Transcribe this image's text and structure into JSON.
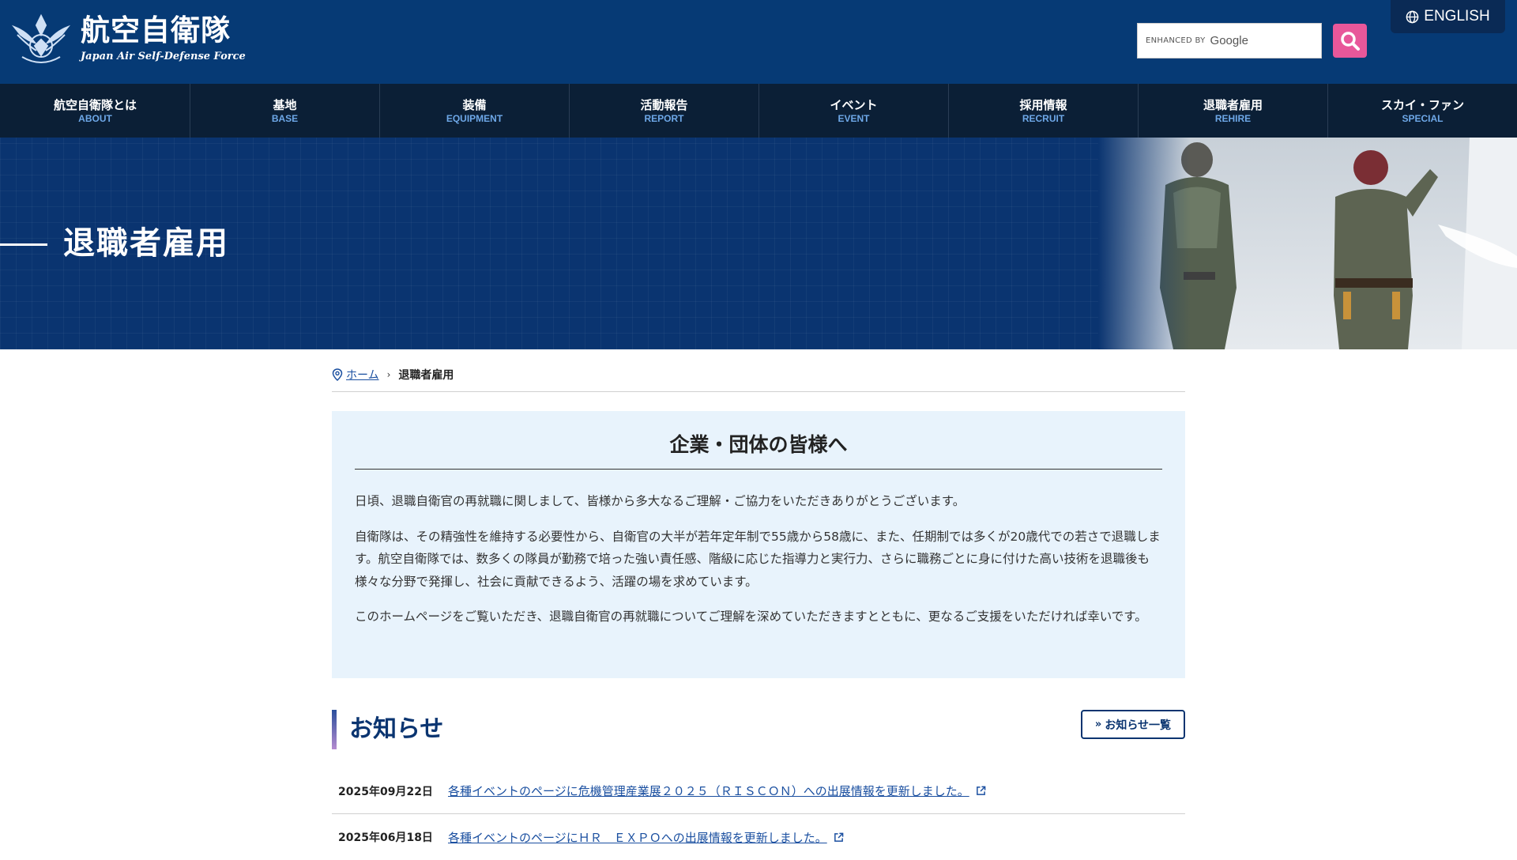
{
  "header": {
    "logo_jp": "航空自衛隊",
    "logo_en": "Japan Air Self-Defense Force",
    "search_enhanced": "ENHANCED BY",
    "search_google": "Google",
    "english_label": "ENGLISH"
  },
  "nav": {
    "items": [
      {
        "jp": "航空自衛隊とは",
        "en": "ABOUT"
      },
      {
        "jp": "基地",
        "en": "BASE"
      },
      {
        "jp": "装備",
        "en": "EQUIPMENT"
      },
      {
        "jp": "活動報告",
        "en": "REPORT"
      },
      {
        "jp": "イベント",
        "en": "EVENT"
      },
      {
        "jp": "採用情報",
        "en": "RECRUIT"
      },
      {
        "jp": "退職者雇用",
        "en": "REHIRE"
      },
      {
        "jp": "スカイ・ファン",
        "en": "SPECIAL"
      }
    ]
  },
  "hero": {
    "title": "退職者雇用"
  },
  "breadcrumb": {
    "home": "ホーム",
    "sep": "›",
    "current": "退職者雇用"
  },
  "message": {
    "title": "企業・団体の皆様へ",
    "p1": "日頃、退職自衛官の再就職に関しまして、皆様から多大なるご理解・ご協力をいただきありがとうございます。",
    "p2": "自衛隊は、その精強性を維持する必要性から、自衛官の大半が若年定年制で55歳から58歳に、また、任期制では多くが20歳代での若さで退職します。航空自衛隊では、数多くの隊員が勤務で培った強い責任感、階級に応じた指導力と実行力、さらに職務ごとに身に付けた高い技術を退職後も様々な分野で発揮し、社会に貢献できるよう、活躍の場を求めています。",
    "p3": "このホームページをご覧いただき、退職自衛官の再就職についてご理解を深めていただきますとともに、更なるご支援をいただければ幸いです。"
  },
  "news": {
    "title": "お知らせ",
    "more_label": "お知らせ一覧",
    "items": [
      {
        "date": "2025年09月22日",
        "text": "各種イベントのページに危機管理産業展２０２５（ＲＩＳＣＯＮ）への出展情報を更新しました。"
      },
      {
        "date": "2025年06月18日",
        "text": "各種イベントのページにＨＲ　ＥＸＰＯへの出展情報を更新しました。"
      }
    ]
  },
  "colors": {
    "header_bg": "#063a75",
    "nav_bg": "#0b1f36",
    "search_btn": "#e8579a",
    "accent": "#0a3470"
  }
}
